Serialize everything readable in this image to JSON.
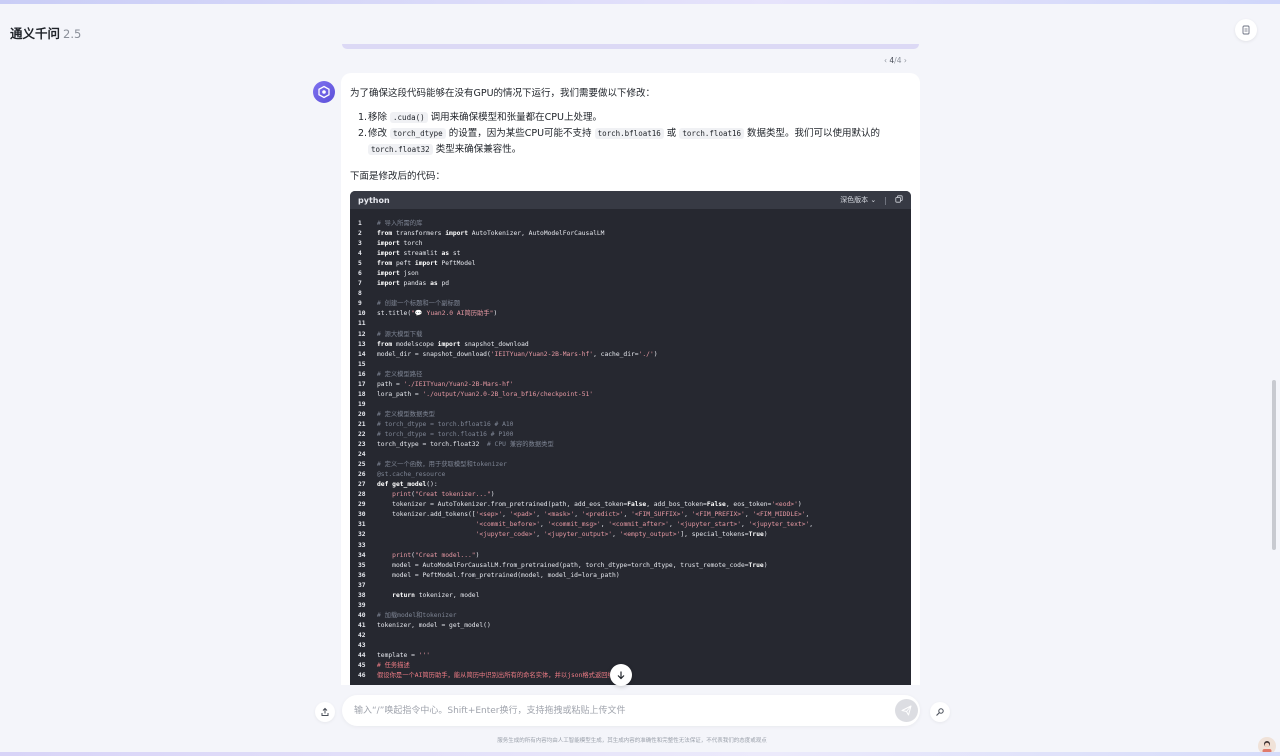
{
  "app": {
    "name": "通义千问",
    "version": "2.5"
  },
  "pager": {
    "current": "4",
    "total": "4",
    "prev": "‹",
    "next": "›",
    "slash": "/"
  },
  "answer": {
    "intro": "为了确保这段代码能够在没有GPU的情况下运行，我们需要做以下修改：",
    "list": [
      {
        "num": "1.",
        "parts": [
          "移除 ",
          ".cuda()",
          " 调用来确保模型和张量都在CPU上处理。"
        ]
      },
      {
        "num": "2.",
        "parts": [
          "修改 ",
          "torch_dtype",
          " 的设置，因为某些CPU可能不支持 ",
          "torch.bfloat16",
          " 或 ",
          "torch.float16",
          " 数据类型。我们可以使用默认的 ",
          "torch.float32",
          " 类型来确保兼容性。"
        ]
      }
    ],
    "after": "下面是修改后的代码："
  },
  "code": {
    "language": "python",
    "theme_label": "深色版本",
    "lines": [
      {
        "n": "1",
        "html": "<span class=\"cm\"># 导入所需的库</span>"
      },
      {
        "n": "2",
        "html": "<span class=\"kw\">from</span> transformers <span class=\"kw\">import</span> AutoTokenizer, AutoModelForCausalLM"
      },
      {
        "n": "3",
        "html": "<span class=\"kw\">import</span> torch"
      },
      {
        "n": "4",
        "html": "<span class=\"kw\">import</span> streamlit <span class=\"kw\">as</span> st"
      },
      {
        "n": "5",
        "html": "<span class=\"kw\">from</span> peft <span class=\"kw\">import</span> PeftModel"
      },
      {
        "n": "6",
        "html": "<span class=\"kw\">import</span> json"
      },
      {
        "n": "7",
        "html": "<span class=\"kw\">import</span> pandas <span class=\"kw\">as</span> pd"
      },
      {
        "n": "8",
        "html": ""
      },
      {
        "n": "9",
        "html": "<span class=\"cm\"># 创建一个标题和一个副标题</span>"
      },
      {
        "n": "10",
        "html": "st.title(<span class=\"st\">\"💬 Yuan2.0 AI简历助手\"</span>)"
      },
      {
        "n": "11",
        "html": ""
      },
      {
        "n": "12",
        "html": "<span class=\"cm\"># 源大模型下载</span>"
      },
      {
        "n": "13",
        "html": "<span class=\"kw\">from</span> modelscope <span class=\"kw\">import</span> snapshot_download"
      },
      {
        "n": "14",
        "html": "model_dir = snapshot_download(<span class=\"st\">'IEITYuan/Yuan2-2B-Mars-hf'</span>, cache_dir=<span class=\"st\">'./'</span>)"
      },
      {
        "n": "15",
        "html": ""
      },
      {
        "n": "16",
        "html": "<span class=\"cm\"># 定义模型路径</span>"
      },
      {
        "n": "17",
        "html": "path = <span class=\"st\">'./IEITYuan/Yuan2-2B-Mars-hf'</span>"
      },
      {
        "n": "18",
        "html": "lora_path = <span class=\"st\">'./output/Yuan2.0-2B_lora_bf16/checkpoint-51'</span>"
      },
      {
        "n": "19",
        "html": ""
      },
      {
        "n": "20",
        "html": "<span class=\"cm\"># 定义模型数据类型</span>"
      },
      {
        "n": "21",
        "html": "<span class=\"cm\"># torch_dtype = torch.bfloat16 # A10</span>"
      },
      {
        "n": "22",
        "html": "<span class=\"cm\"># torch_dtype = torch.float16 # P100</span>"
      },
      {
        "n": "23",
        "html": "torch_dtype = torch.float32  <span class=\"cm\"># CPU 兼容的数据类型</span>"
      },
      {
        "n": "24",
        "html": ""
      },
      {
        "n": "25",
        "html": "<span class=\"cm\"># 定义一个函数，用于获取模型和tokenizer</span>"
      },
      {
        "n": "26",
        "html": "<span class=\"cm\">@st.cache_resource</span>"
      },
      {
        "n": "27",
        "html": "<span class=\"kw\">def get_model</span>():"
      },
      {
        "n": "28",
        "html": "    <span class=\"st\">print</span>(<span class=\"st\">\"Creat tokenizer...\"</span>)"
      },
      {
        "n": "29",
        "html": "    tokenizer = AutoTokenizer.from_pretrained(path, add_eos_token=<span class=\"kw\">False</span>, add_bos_token=<span class=\"kw\">False</span>, eos_token=<span class=\"st\">'&lt;eod&gt;'</span>)"
      },
      {
        "n": "30",
        "html": "    tokenizer.add_tokens([<span class=\"st\">'&lt;sep&gt;'</span>, <span class=\"st\">'&lt;pad&gt;'</span>, <span class=\"st\">'&lt;mask&gt;'</span>, <span class=\"st\">'&lt;predict&gt;'</span>, <span class=\"st\">'&lt;FIM_SUFFIX&gt;'</span>, <span class=\"st\">'&lt;FIM_PREFIX&gt;'</span>, <span class=\"st\">'&lt;FIM_MIDDLE&gt;'</span>,"
      },
      {
        "n": "31",
        "html": "                          <span class=\"st\">'&lt;commit_before&gt;'</span>, <span class=\"st\">'&lt;commit_msg&gt;'</span>, <span class=\"st\">'&lt;commit_after&gt;'</span>, <span class=\"st\">'&lt;jupyter_start&gt;'</span>, <span class=\"st\">'&lt;jupyter_text&gt;'</span>,"
      },
      {
        "n": "32",
        "html": "                          <span class=\"st\">'&lt;jupyter_code&gt;'</span>, <span class=\"st\">'&lt;jupyter_output&gt;'</span>, <span class=\"st\">'&lt;empty_output&gt;'</span>], special_tokens=<span class=\"kw\">True</span>)"
      },
      {
        "n": "33",
        "html": ""
      },
      {
        "n": "34",
        "html": "    <span class=\"st\">print</span>(<span class=\"st\">\"Creat model...\"</span>)"
      },
      {
        "n": "35",
        "html": "    model = AutoModelForCausalLM.from_pretrained(path, torch_dtype=torch_dtype, trust_remote_code=<span class=\"kw\">True</span>)"
      },
      {
        "n": "36",
        "html": "    model = PeftModel.from_pretrained(model, model_id=lora_path)"
      },
      {
        "n": "37",
        "html": ""
      },
      {
        "n": "38",
        "html": "    <span class=\"kw\">return</span> tokenizer, model"
      },
      {
        "n": "39",
        "html": ""
      },
      {
        "n": "40",
        "html": "<span class=\"cm\"># 加载model和tokenizer</span>"
      },
      {
        "n": "41",
        "html": "tokenizer, model = get_model()"
      },
      {
        "n": "42",
        "html": ""
      },
      {
        "n": "43",
        "html": ""
      },
      {
        "n": "44",
        "html": "template = <span class=\"st\">'''</span>"
      },
      {
        "n": "45",
        "html": "<span class=\"em\"># 任务描述</span>"
      },
      {
        "n": "46",
        "html": "<span class=\"em\">假设你是一个AI简历助手，能从简历中识别出所有的命名实体，并以json格式返回结果。</span>"
      }
    ]
  },
  "input": {
    "placeholder": "输入“/”唤起指令中心。Shift+Enter换行，支持拖拽或粘贴上传文件"
  },
  "disclaimer": "服务生成的所有内容均由人工智能模型生成，其生成内容的准确性和完整性无法保证，不代表我们的态度或观点"
}
